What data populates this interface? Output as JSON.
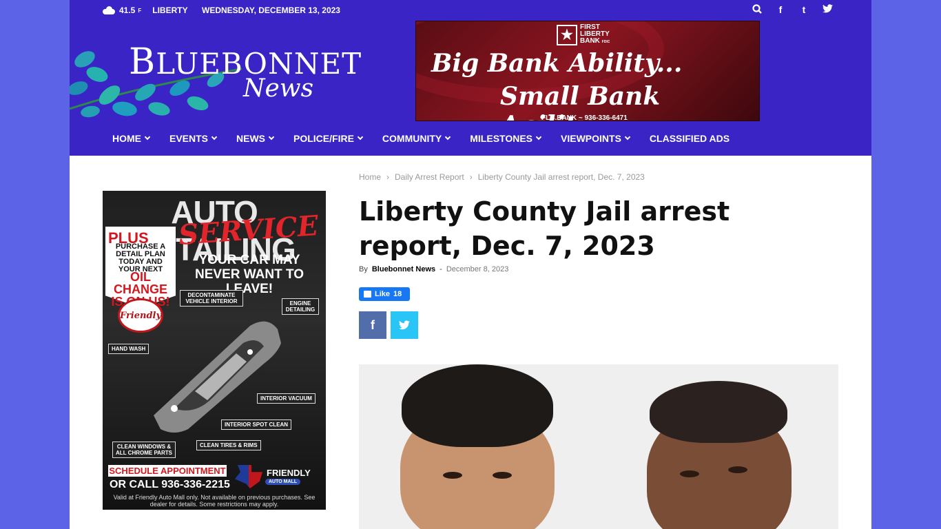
{
  "topbar": {
    "temperature": "41.5",
    "temp_unit": "F",
    "city": "LIBERTY",
    "date": "WEDNESDAY, DECEMBER 13, 2023",
    "icons": [
      "search-icon",
      "facebook-icon",
      "tumblr-icon",
      "twitter-icon"
    ]
  },
  "logo": {
    "first_letter": "B",
    "rest": "LUEBONNET",
    "sub": "News"
  },
  "banner": {
    "bank_line1": "FIRST",
    "bank_line2": "LIBERTY",
    "bank_line3": "BANK",
    "bank_fdic": "FDIC",
    "slogan1": "Big Bank Ability...",
    "slogan2": "Small Bank Agility",
    "url": "FLB.BANK ~ 936-336-6471"
  },
  "nav": {
    "items": [
      {
        "label": "HOME",
        "dropdown": true
      },
      {
        "label": "EVENTS",
        "dropdown": true
      },
      {
        "label": "NEWS",
        "dropdown": true
      },
      {
        "label": "POLICE/FIRE",
        "dropdown": true
      },
      {
        "label": "COMMUNITY",
        "dropdown": true
      },
      {
        "label": "MILESTONES",
        "dropdown": true
      },
      {
        "label": "VIEWPOINTS",
        "dropdown": true
      },
      {
        "label": "CLASSIFIED ADS",
        "dropdown": false
      }
    ]
  },
  "side_ad": {
    "headline": "AUTO DETAILING",
    "service": "SERVICE",
    "plus": "PLUS",
    "plus_text": "PURCHASE A DETAIL PLAN TODAY AND YOUR NEXT",
    "oil": "OIL CHANGE IS ON US!",
    "tagline": "YOUR CAR MAY NEVER WANT TO LEAVE!",
    "friendly_badge": "Friendly",
    "labels": {
      "decontaminate": "DECONTAMINATE VEHICLE INTERIOR",
      "engine": "ENGINE DETAILING",
      "hand_wash": "HAND WASH",
      "interior_vacuum": "INTERIOR VACUUM",
      "interior_spot": "INTERIOR SPOT CLEAN",
      "windows": "CLEAN WINDOWS & ALL CHROME PARTS",
      "tires": "CLEAN TIRES & RIMS"
    },
    "schedule": "SCHEDULE APPOINTMENT",
    "call": "OR CALL 936-336-2215",
    "fine_print": "Valid at Friendly Auto Mall only. Not available on previous purchases. See dealer for details. Some restrictions may apply.",
    "mall_name": "FRIENDLY",
    "mall_sub": "AUTO MALL"
  },
  "article": {
    "breadcrumb": [
      "Home",
      "Daily Arrest Report",
      "Liberty County Jail arrest report, Dec. 7, 2023"
    ],
    "breadcrumb_sep": "›",
    "title": "Liberty County Jail arrest report, Dec. 7, 2023",
    "by": "By",
    "author": "Bluebonnet News",
    "dash": "-",
    "date": "December 8, 2023",
    "like_label": "Like",
    "like_count": "18",
    "share_facebook": "f",
    "share_twitter": "t"
  },
  "colors": {
    "background": "#5d63e6",
    "header": "#3a24c6",
    "facebook": "#516eab",
    "twitter": "#29c5f6",
    "like": "#1877f2"
  }
}
